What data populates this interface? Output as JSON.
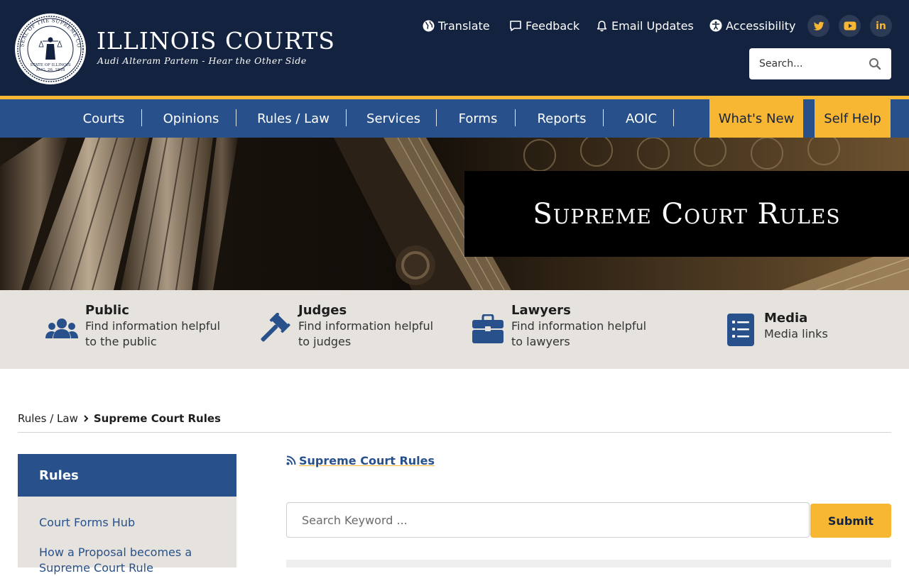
{
  "header": {
    "seal": {
      "outer_text": "SEAL OF THE SUPREME COURT",
      "inner_text_1": "STATE OF ILLINOIS",
      "inner_text_2": "AUG. 26, 1818"
    },
    "title": "ILLINOIS COURTS",
    "tagline": "Audi Alteram Partem - Hear the Other Side",
    "utility_links": [
      {
        "label": "Translate",
        "icon": "globe-icon"
      },
      {
        "label": "Feedback",
        "icon": "comment-icon"
      },
      {
        "label": "Email Updates",
        "icon": "bell-icon"
      },
      {
        "label": "Accessibility",
        "icon": "universal-access-icon"
      }
    ],
    "social": [
      {
        "name": "twitter",
        "glyph": "🐦"
      },
      {
        "name": "youtube",
        "glyph": "▶"
      },
      {
        "name": "linkedin",
        "glyph": "in"
      }
    ],
    "search": {
      "placeholder": "Search..."
    }
  },
  "nav": {
    "items": [
      "Courts",
      "Opinions",
      "Rules / Law",
      "Services",
      "Forms",
      "Reports",
      "AOIC"
    ],
    "cta": [
      "What's New",
      "Self Help"
    ]
  },
  "hero": {
    "title": "Supreme Court Rules"
  },
  "audience": [
    {
      "title": "Public",
      "desc_line1": "Find information helpful",
      "desc_line2": "to the public",
      "icon": "users-icon"
    },
    {
      "title": "Judges",
      "desc_line1": "Find information helpful",
      "desc_line2": "to judges",
      "icon": "gavel-icon"
    },
    {
      "title": "Lawyers",
      "desc_line1": "Find information helpful",
      "desc_line2": "to lawyers",
      "icon": "briefcase-icon"
    },
    {
      "title": "Media",
      "desc_line1": "Media links",
      "icon": "list-icon"
    }
  ],
  "breadcrumb": {
    "parent": "Rules / Law",
    "current": "Supreme Court Rules"
  },
  "sidebar": {
    "heading": "Rules",
    "links": [
      "Court Forms Hub",
      "How a Proposal becomes a",
      "Supreme Court Rule"
    ]
  },
  "main": {
    "rss_label": "Supreme Court Rules",
    "search": {
      "placeholder": "Search Keyword ...",
      "submit_label": "Submit"
    }
  },
  "colors": {
    "header_bg": "#13223f",
    "nav_bg": "#28508a",
    "accent_gold": "#f7b733",
    "band_bg": "#e6e3df"
  }
}
